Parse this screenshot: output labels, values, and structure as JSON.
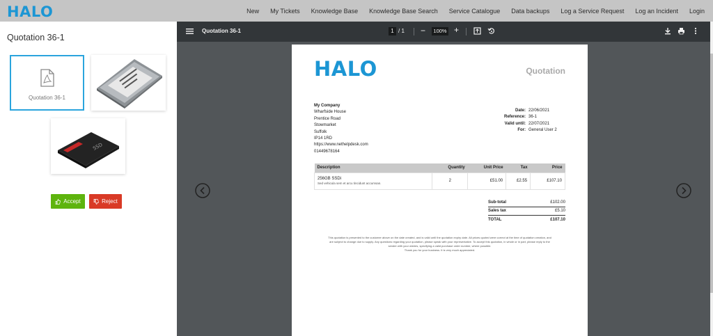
{
  "brand": {
    "logo_text": "HALO",
    "color": "#1c96d4"
  },
  "nav": {
    "items": [
      "New",
      "My Tickets",
      "Knowledge Base",
      "Knowledge Base Search",
      "Service Catalogue",
      "Data backups",
      "Log a Service Request",
      "Log an Incident",
      "Login"
    ]
  },
  "left_panel": {
    "title": "Quotation 36-1",
    "attachments": [
      {
        "label": "Quotation 36-1",
        "type": "pdf",
        "icon": "pdf-file-icon"
      },
      {
        "label": "",
        "type": "image",
        "icon": "ssd-photo"
      },
      {
        "label": "",
        "type": "image",
        "icon": "ssd-photo"
      }
    ],
    "accept_label": "Accept",
    "reject_label": "Reject",
    "accept_color": "#5eb40e",
    "reject_color": "#d93a26"
  },
  "viewer": {
    "title": "Quotation 36-1",
    "page_current": "1",
    "page_total": "/ 1",
    "zoom": "100%",
    "zoom_minus": "−",
    "zoom_plus": "+"
  },
  "document": {
    "logo_text": "HALO",
    "heading": "Quotation",
    "company": {
      "name": "My Company",
      "lines": [
        "Wharfside House",
        "Prentice Road",
        "Stowmarket",
        "Suffolk",
        "IP14 1RD",
        "https://www.nethelpdesk.com",
        "01449678164"
      ]
    },
    "meta": [
      {
        "key": "Date:",
        "value": "22/06/2021"
      },
      {
        "key": "Reference:",
        "value": "36-1"
      },
      {
        "key": "Valid until:",
        "value": "22/07/2021"
      },
      {
        "key": "For:",
        "value": "General User 2"
      }
    ],
    "table": {
      "headers": [
        "Description",
        "Quantity",
        "Unit Price",
        "Tax",
        "Price"
      ],
      "rows": [
        {
          "description": "256GB SSDi",
          "sub": "Sed vehicula sem et arcu tincidunt accumsan.",
          "quantity": "2",
          "unit_price": "£51.00",
          "tax": "£2.55",
          "price": "£107.10"
        }
      ]
    },
    "totals": [
      {
        "key": "Sub-total",
        "value": "£102.00"
      },
      {
        "key": "Sales tax",
        "value": "£5.10"
      },
      {
        "key": "TOTAL",
        "value": "£107.10"
      }
    ],
    "footer": [
      "This quotation is presented to the customer above on the date created, and is valid until the quotation expiry date. All prices quoted were correct at the time of quotation creation, and",
      "are subject to change due to supply. Any questions regarding your quotation, please speak with your representative. To accept this quotation, in whole or in part, please reply to the",
      "sender with your wishes, specifying a valid purchase order number, where possible.",
      "Thank you for your business. It is very much appreciated."
    ]
  }
}
